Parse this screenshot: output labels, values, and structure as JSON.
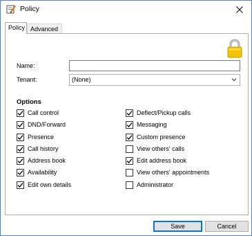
{
  "window": {
    "title": "Policy"
  },
  "tabs": [
    {
      "label": "Policy",
      "active": true
    },
    {
      "label": "Advanced",
      "active": false
    }
  ],
  "form": {
    "name_label": "Name:",
    "name_value": "",
    "tenant_label": "Tenant:",
    "tenant_value": "(None)"
  },
  "options": {
    "title": "Options",
    "left": [
      {
        "label": "Call control",
        "checked": true
      },
      {
        "label": "DND/Forward",
        "checked": true
      },
      {
        "label": "Presence",
        "checked": true
      },
      {
        "label": "Call history",
        "checked": true
      },
      {
        "label": "Address book",
        "checked": true
      },
      {
        "label": "Availability",
        "checked": true
      },
      {
        "label": "Edit own details",
        "checked": true
      }
    ],
    "right": [
      {
        "label": "Deflect/Pickup calls",
        "checked": true
      },
      {
        "label": "Messaging",
        "checked": true
      },
      {
        "label": "Custom presence",
        "checked": true
      },
      {
        "label": "View others' calls",
        "checked": false
      },
      {
        "label": "Edit address book",
        "checked": true
      },
      {
        "label": "View others' appointments",
        "checked": false
      },
      {
        "label": "Administrator",
        "checked": false
      }
    ]
  },
  "buttons": {
    "save": "Save",
    "cancel": "Cancel"
  },
  "icons": {
    "app": "edit-pencil-icon",
    "lock": "padlock-icon",
    "close": "close-icon"
  },
  "colors": {
    "lock_body": "#f5c400",
    "accent": "#0078d7"
  }
}
